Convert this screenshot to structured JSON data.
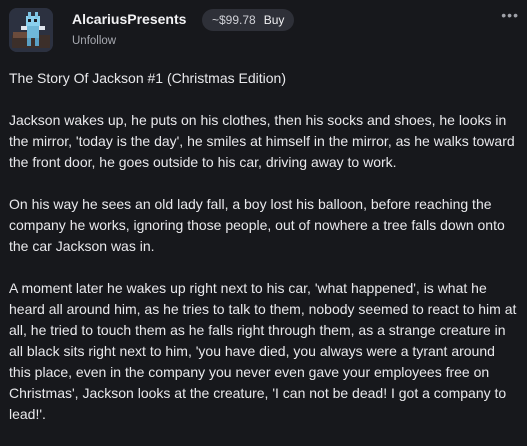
{
  "post": {
    "author": "AlcariusPresents",
    "price": "~$99.78",
    "buy_label": "Buy",
    "follow_label": "Unfollow",
    "more_icon": "ellipsis-icon",
    "paragraphs": [
      "The Story Of Jackson #1 (Christmas Edition)",
      "Jackson wakes up, he puts on his clothes, then his socks and shoes, he looks in the mirror, 'today is the day', he smiles at himself in the mirror, as he walks toward the front door, he goes outside to his car, driving away to work.",
      "On his way he sees an old lady fall, a boy lost his balloon, before reaching the company he works, ignoring those people, out of nowhere a tree falls down onto the car Jackson was in.",
      "A moment later he wakes up right next to his car, 'what happened', is what he heard all around him, as he tries to talk to them, nobody seemed to react to him at all, he tried to touch them as he falls right through them, as a strange creature in all black sits right next to him, 'you have died, you always were a tyrant around this place, even in the company you never even gave your employees free on Christmas', Jackson looks at the creature, 'I can not be dead! I got a company to lead!'."
    ]
  },
  "colors": {
    "background": "#17181c",
    "pill": "#2e3038",
    "text": "#e9e9ec",
    "muted": "#a7a9b0"
  }
}
